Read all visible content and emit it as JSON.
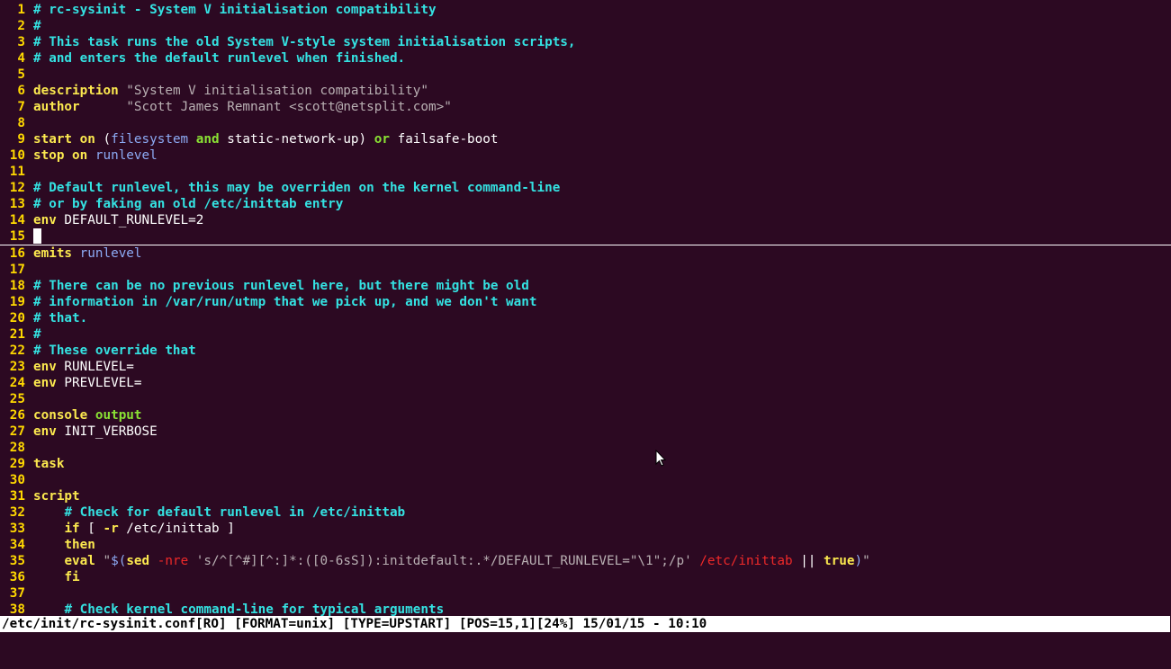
{
  "lines": [
    {
      "n": "1",
      "tokens": [
        [
          "comment",
          "# rc-sysinit - System V initialisation compatibility"
        ]
      ]
    },
    {
      "n": "2",
      "tokens": [
        [
          "comment",
          "#"
        ]
      ]
    },
    {
      "n": "3",
      "tokens": [
        [
          "comment",
          "# This task runs the old System V-style system initialisation scripts,"
        ]
      ]
    },
    {
      "n": "4",
      "tokens": [
        [
          "comment",
          "# and enters the default runlevel when finished."
        ]
      ]
    },
    {
      "n": "5",
      "tokens": []
    },
    {
      "n": "6",
      "tokens": [
        [
          "keyword",
          "description"
        ],
        [
          "plain",
          " "
        ],
        [
          "string",
          "\"System V initialisation compatibility\""
        ]
      ]
    },
    {
      "n": "7",
      "tokens": [
        [
          "keyword",
          "author"
        ],
        [
          "plain",
          "      "
        ],
        [
          "string",
          "\"Scott James Remnant <scott@netsplit.com>\""
        ]
      ]
    },
    {
      "n": "8",
      "tokens": []
    },
    {
      "n": "9",
      "tokens": [
        [
          "keyword",
          "start on"
        ],
        [
          "plain",
          " ("
        ],
        [
          "ident",
          "filesystem"
        ],
        [
          "plain",
          " "
        ],
        [
          "green",
          "and"
        ],
        [
          "plain",
          " static-network-up) "
        ],
        [
          "green",
          "or"
        ],
        [
          "plain",
          " failsafe-boot"
        ]
      ]
    },
    {
      "n": "10",
      "tokens": [
        [
          "keyword",
          "stop on"
        ],
        [
          "plain",
          " "
        ],
        [
          "ident",
          "runlevel"
        ]
      ]
    },
    {
      "n": "11",
      "tokens": []
    },
    {
      "n": "12",
      "tokens": [
        [
          "comment",
          "# Default runlevel, this may be overriden on the kernel command-line"
        ]
      ]
    },
    {
      "n": "13",
      "tokens": [
        [
          "comment",
          "# or by faking an old /etc/inittab entry"
        ]
      ]
    },
    {
      "n": "14",
      "tokens": [
        [
          "keyword",
          "env"
        ],
        [
          "plain",
          " DEFAULT_RUNLEVEL=2"
        ]
      ]
    },
    {
      "n": "15",
      "tokens": [],
      "cursor": true
    },
    {
      "n": "16",
      "tokens": [
        [
          "keyword",
          "emits"
        ],
        [
          "plain",
          " "
        ],
        [
          "ident",
          "runlevel"
        ]
      ]
    },
    {
      "n": "17",
      "tokens": []
    },
    {
      "n": "18",
      "tokens": [
        [
          "comment",
          "# There can be no previous runlevel here, but there might be old"
        ]
      ]
    },
    {
      "n": "19",
      "tokens": [
        [
          "comment",
          "# information in /var/run/utmp that we pick up, and we don't want"
        ]
      ]
    },
    {
      "n": "20",
      "tokens": [
        [
          "comment",
          "# that."
        ]
      ]
    },
    {
      "n": "21",
      "tokens": [
        [
          "comment",
          "#"
        ]
      ]
    },
    {
      "n": "22",
      "tokens": [
        [
          "comment",
          "# These override that"
        ]
      ]
    },
    {
      "n": "23",
      "tokens": [
        [
          "keyword",
          "env"
        ],
        [
          "plain",
          " RUNLEVEL="
        ]
      ]
    },
    {
      "n": "24",
      "tokens": [
        [
          "keyword",
          "env"
        ],
        [
          "plain",
          " PREVLEVEL="
        ]
      ]
    },
    {
      "n": "25",
      "tokens": []
    },
    {
      "n": "26",
      "tokens": [
        [
          "keyword",
          "console"
        ],
        [
          "plain",
          " "
        ],
        [
          "green",
          "output"
        ]
      ]
    },
    {
      "n": "27",
      "tokens": [
        [
          "keyword",
          "env"
        ],
        [
          "plain",
          " INIT_VERBOSE"
        ]
      ]
    },
    {
      "n": "28",
      "tokens": []
    },
    {
      "n": "29",
      "tokens": [
        [
          "keyword",
          "task"
        ]
      ]
    },
    {
      "n": "30",
      "tokens": []
    },
    {
      "n": "31",
      "tokens": [
        [
          "keyword",
          "script"
        ]
      ]
    },
    {
      "n": "32",
      "tokens": [
        [
          "plain",
          "    "
        ],
        [
          "comment",
          "# Check for default runlevel in /etc/inittab"
        ]
      ]
    },
    {
      "n": "33",
      "tokens": [
        [
          "plain",
          "    "
        ],
        [
          "keyword",
          "if"
        ],
        [
          "plain",
          " [ "
        ],
        [
          "keyword",
          "-r"
        ],
        [
          "plain",
          " /etc/inittab ]"
        ]
      ]
    },
    {
      "n": "34",
      "tokens": [
        [
          "plain",
          "    "
        ],
        [
          "keyword",
          "then"
        ]
      ]
    },
    {
      "n": "35",
      "tokens": [
        [
          "plain",
          "    "
        ],
        [
          "keyword",
          "eval"
        ],
        [
          "plain",
          " "
        ],
        [
          "string",
          "\""
        ],
        [
          "ident",
          "$("
        ],
        [
          "keyword",
          "sed"
        ],
        [
          "plain",
          " "
        ],
        [
          "red",
          "-nre"
        ],
        [
          "plain",
          " "
        ],
        [
          "string",
          "'s/^[^#][^:]*:([0-6sS]):initdefault:.*/DEFAULT_RUNLEVEL=\"\\1\";/p'"
        ],
        [
          "plain",
          " "
        ],
        [
          "red",
          "/etc/inittab"
        ],
        [
          "plain",
          " || "
        ],
        [
          "keyword",
          "true"
        ],
        [
          "ident",
          ")"
        ],
        [
          "string",
          "\""
        ]
      ]
    },
    {
      "n": "36",
      "tokens": [
        [
          "plain",
          "    "
        ],
        [
          "keyword",
          "fi"
        ]
      ]
    },
    {
      "n": "37",
      "tokens": []
    },
    {
      "n": "38",
      "tokens": [
        [
          "plain",
          "    "
        ],
        [
          "comment",
          "# Check kernel command-line for typical arguments"
        ]
      ]
    }
  ],
  "statusline": {
    "text": "/etc/init/rc-sysinit.conf[RO] [FORMAT=unix] [TYPE=UPSTART] [POS=15,1][24%] 15/01/15 - 10:10"
  }
}
